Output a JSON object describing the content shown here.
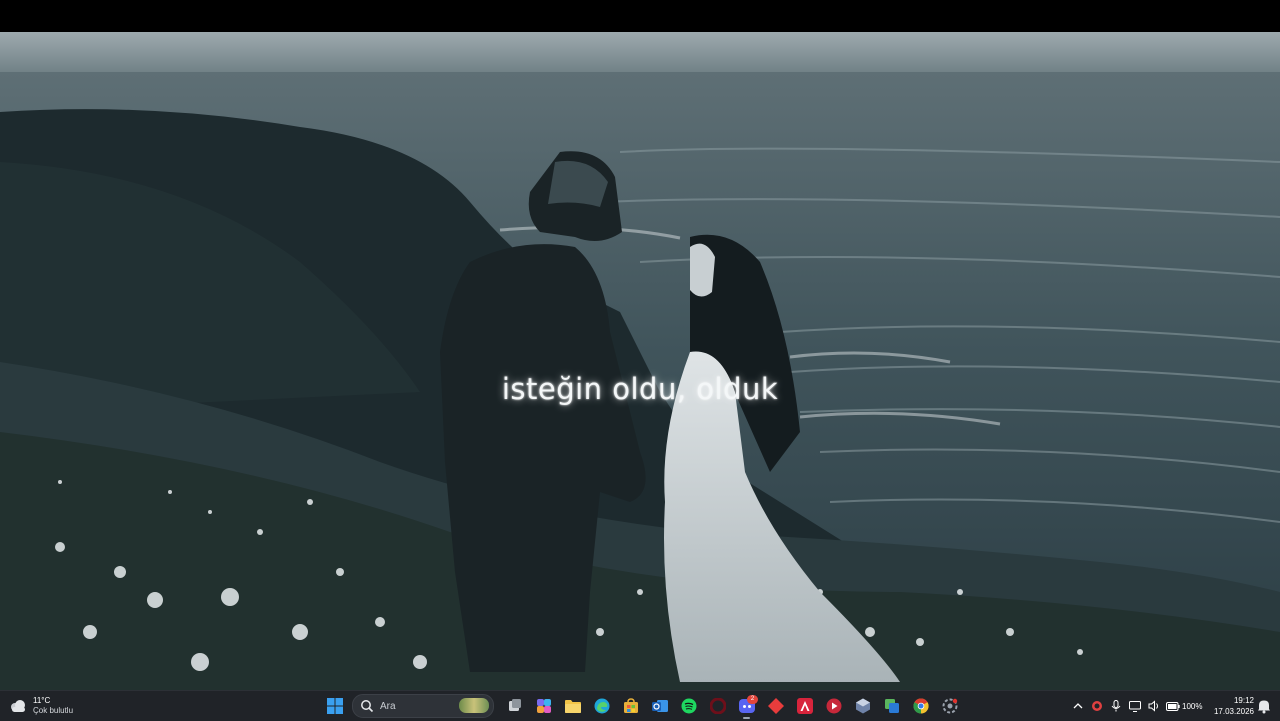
{
  "video": {
    "subtitle": "isteğin oldu, olduk"
  },
  "taskbar": {
    "weather": {
      "temperature": "11°C",
      "condition": "Çok bulutlu",
      "icon": "cloud-icon"
    },
    "search": {
      "placeholder": "Ara",
      "icon": "search-icon"
    },
    "apps": [
      {
        "name": "start",
        "icon": "windows-icon",
        "color": "#3aa0f0"
      },
      {
        "name": "file-explorer",
        "icon": "folder-icon",
        "color": "#f2c447"
      },
      {
        "name": "edge",
        "icon": "edge-icon",
        "color": "#1fa6d9"
      },
      {
        "name": "store",
        "icon": "store-icon",
        "color": "#e8b03a"
      },
      {
        "name": "outlook",
        "icon": "outlook-icon",
        "color": "#2f7fd8"
      },
      {
        "name": "spotify",
        "icon": "spotify-icon",
        "color": "#1ed760"
      },
      {
        "name": "opera",
        "icon": "opera-icon",
        "color": "#d01f2f"
      },
      {
        "name": "discord",
        "icon": "discord-icon",
        "color": "#5865f2",
        "badge": "2"
      },
      {
        "name": "red-app",
        "icon": "diamond-icon",
        "color": "#e83c3c"
      },
      {
        "name": "adobe",
        "icon": "adobe-icon",
        "color": "#d8243c"
      },
      {
        "name": "media-player",
        "icon": "play-icon",
        "color": "#c7283a"
      },
      {
        "name": "game-app",
        "icon": "cube-icon",
        "color": "#7b8fb0"
      },
      {
        "name": "snipping",
        "icon": "snip-icon",
        "color": "#5ab55e"
      },
      {
        "name": "chrome",
        "icon": "chrome-icon",
        "color": "#e9b325"
      },
      {
        "name": "settings-app",
        "icon": "gear-icon",
        "color": "#9aa2ad"
      }
    ],
    "tray": {
      "battery_percent": "100%"
    },
    "clock": {
      "time": "19:12",
      "date": "17.03.2026"
    }
  }
}
